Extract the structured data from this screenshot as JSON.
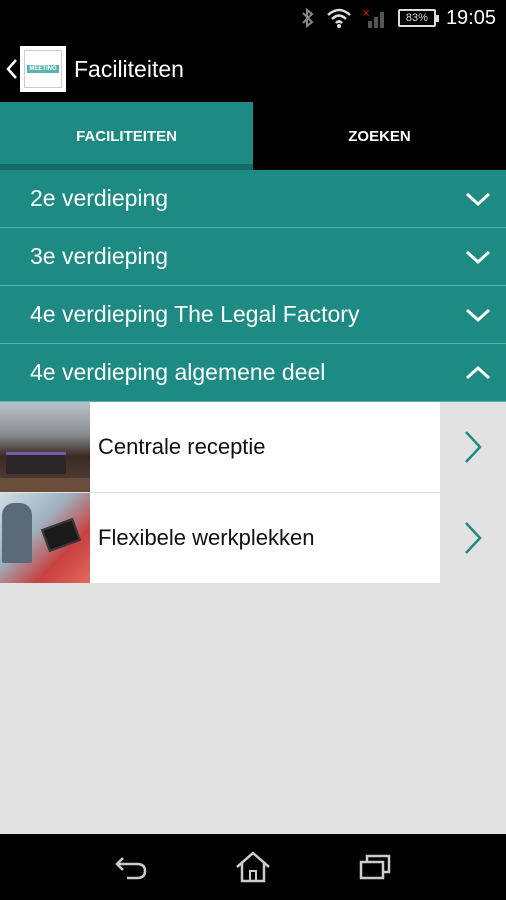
{
  "status_bar": {
    "battery": "83%",
    "time": "19:05",
    "icons": [
      "bluetooth-icon",
      "wifi-icon",
      "signal-icon",
      "battery-icon"
    ]
  },
  "action_bar": {
    "title": "Faciliteiten",
    "logo_lines": [
      "MEETING"
    ]
  },
  "tabs": [
    {
      "label": "FACILITEITEN",
      "active": true
    },
    {
      "label": "ZOEKEN",
      "active": false
    }
  ],
  "floors": [
    {
      "label": "2e verdieping",
      "expanded": false
    },
    {
      "label": "3e verdieping",
      "expanded": false
    },
    {
      "label": "4e verdieping The Legal Factory",
      "expanded": false
    },
    {
      "label": "4e verdieping algemene deel",
      "expanded": true
    }
  ],
  "facilities": [
    {
      "label": "Centrale receptie"
    },
    {
      "label": "Flexibele werkplekken"
    }
  ],
  "colors": {
    "accent": "#1d8a84",
    "accent_dark": "#156b66",
    "background": "#e2e2e2"
  }
}
